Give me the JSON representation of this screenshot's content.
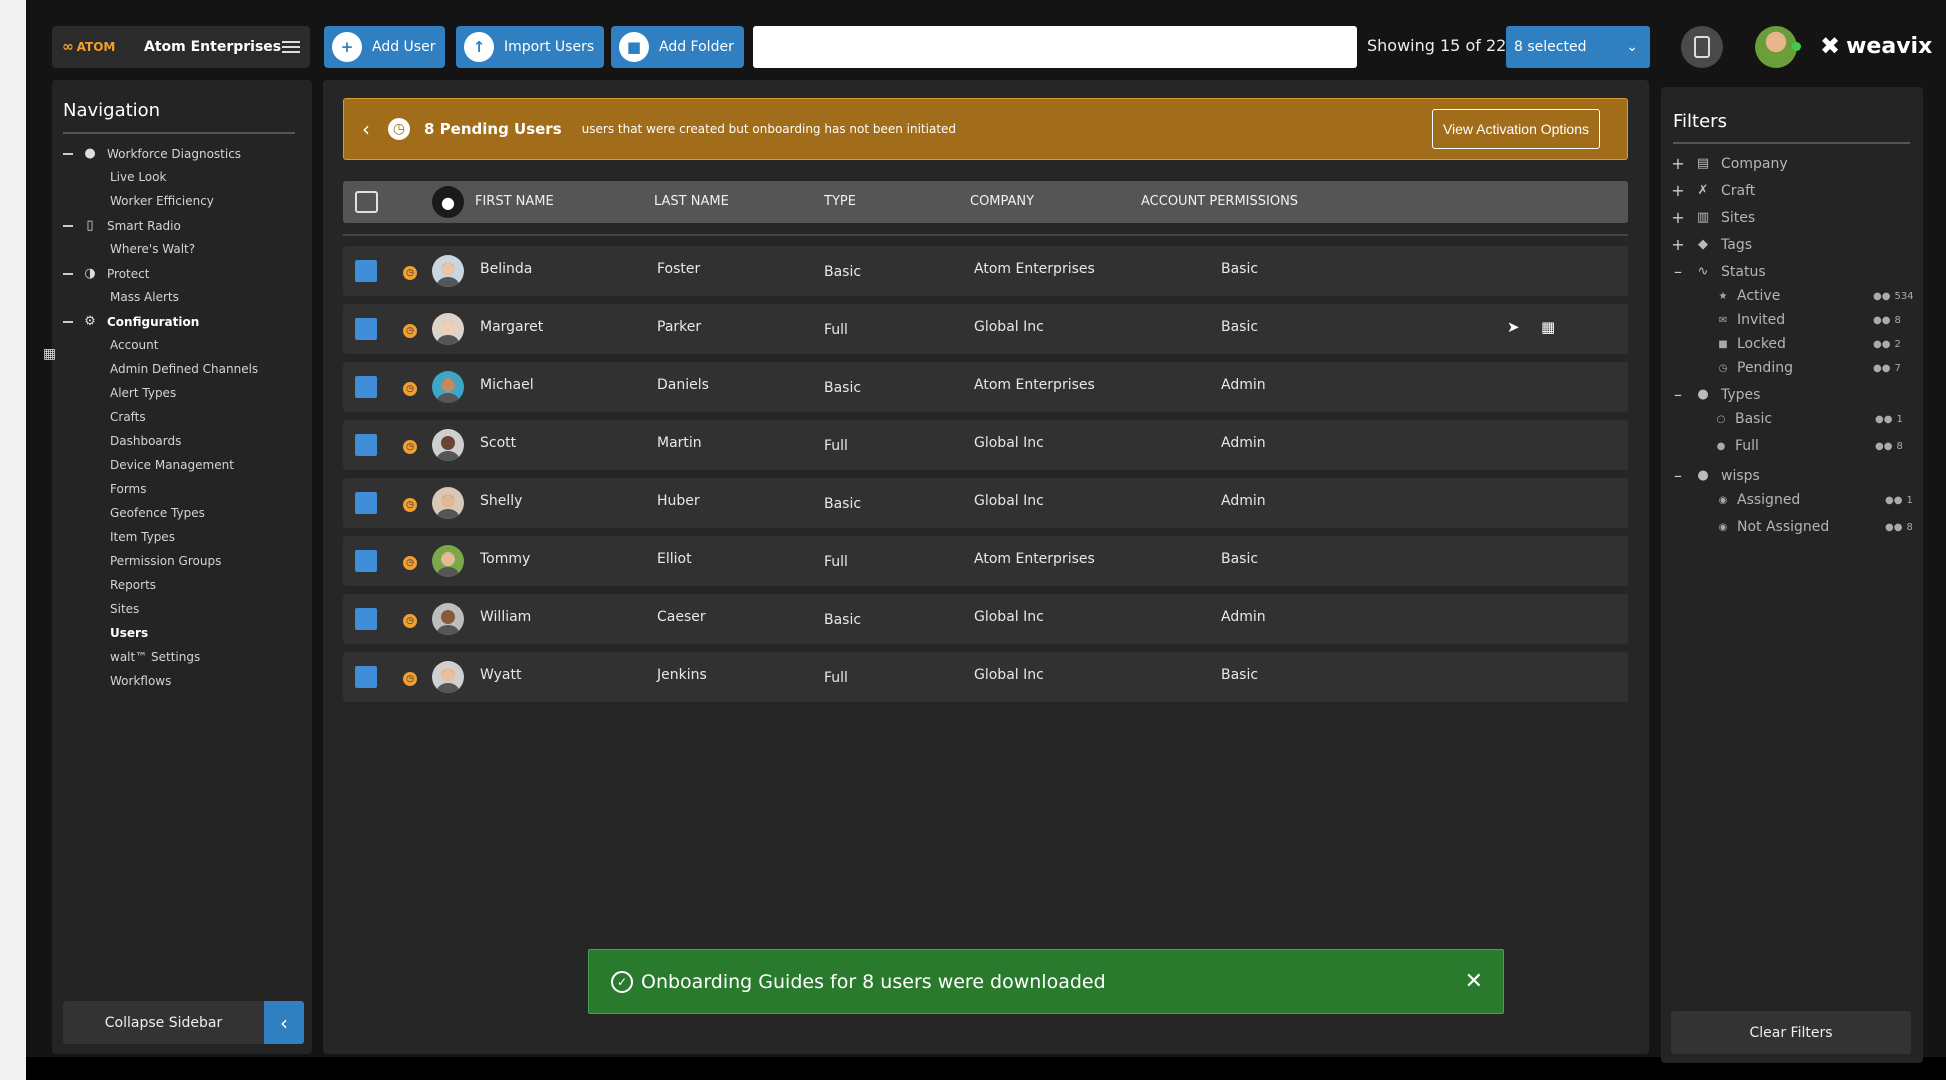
{
  "header": {
    "logo_text": "ATOM",
    "org_name": "Atom Enterprises",
    "add_user": "Add User",
    "import_users": "Import Users",
    "add_folder": "Add Folder",
    "search_placeholder": "",
    "showing": "Showing 15 of 22",
    "selected": "8 selected",
    "brand": "weavix"
  },
  "sidebar": {
    "title": "Navigation",
    "groups": [
      {
        "label": "Workforce Diagnostics",
        "icon": "person-icon",
        "items": [
          "Live Look",
          "Worker Efficiency"
        ]
      },
      {
        "label": "Smart Radio",
        "icon": "radio-icon",
        "items": [
          "Where's Walt?"
        ]
      },
      {
        "label": "Protect",
        "icon": "shield-icon",
        "items": [
          "Mass Alerts"
        ]
      },
      {
        "label": "Configuration",
        "icon": "gear-icon",
        "items": [
          "Account",
          "Admin Defined Channels",
          "Alert Types",
          "Crafts",
          "Dashboards",
          "Device Management",
          "Forms",
          "Geofence Types",
          "Item Types",
          "Permission Groups",
          "Reports",
          "Sites",
          "Users",
          "walt™ Settings",
          "Workflows"
        ]
      }
    ],
    "collapse_label": "Collapse Sidebar"
  },
  "banner": {
    "title": "8 Pending Users",
    "description": "users that were created but onboarding has not been initiated",
    "button": "View Activation Options"
  },
  "table": {
    "columns": [
      "FIRST NAME",
      "LAST NAME",
      "TYPE",
      "COMPANY",
      "ACCOUNT PERMISSIONS"
    ],
    "rows": [
      {
        "first": "Belinda",
        "last": "Foster",
        "type": "Basic",
        "company": "Atom Enterprises",
        "permissions": "Basic",
        "skin": "#e8c4a8",
        "hair": "#6b4a30",
        "bg": "#c9d6e0"
      },
      {
        "first": "Margaret",
        "last": "Parker",
        "type": "Full",
        "company": "Global Inc",
        "permissions": "Basic",
        "skin": "#f0cfb5",
        "hair": "#b0602e",
        "bg": "#dcd3cb"
      },
      {
        "first": "Michael",
        "last": "Daniels",
        "type": "Basic",
        "company": "Atom Enterprises",
        "permissions": "Admin",
        "skin": "#c48a62",
        "hair": "#2a1c14",
        "bg": "#3ba7c9"
      },
      {
        "first": "Scott",
        "last": "Martin",
        "type": "Full",
        "company": "Global Inc",
        "permissions": "Admin",
        "skin": "#6b4530",
        "hair": "#1c1c1c",
        "bg": "#cfcfcf"
      },
      {
        "first": "Shelly",
        "last": "Huber",
        "type": "Basic",
        "company": "Global Inc",
        "permissions": "Admin",
        "skin": "#e2b894",
        "hair": "#4a3222",
        "bg": "#d8c8b8"
      },
      {
        "first": "Tommy",
        "last": "Elliot",
        "type": "Full",
        "company": "Atom Enterprises",
        "permissions": "Basic",
        "skin": "#e6bc98",
        "hair": "#3a2a1c",
        "bg": "#7aa84a"
      },
      {
        "first": "William",
        "last": "Caeser",
        "type": "Basic",
        "company": "Global Inc",
        "permissions": "Admin",
        "skin": "#8a5a3c",
        "hair": "#1a1a1a",
        "bg": "#bdbdbd"
      },
      {
        "first": "Wyatt",
        "last": "Jenkins",
        "type": "Full",
        "company": "Global Inc",
        "permissions": "Basic",
        "skin": "#e6c0a0",
        "hair": "#5a3e28",
        "bg": "#d0d0d0"
      }
    ]
  },
  "toast": {
    "message": "Onboarding Guides for 8 users were downloaded"
  },
  "filters": {
    "title": "Filters",
    "collapsed": [
      {
        "label": "Company",
        "icon": "building-icon"
      },
      {
        "label": "Craft",
        "icon": "tools-icon"
      },
      {
        "label": "Sites",
        "icon": "site-icon"
      },
      {
        "label": "Tags",
        "icon": "tag-icon"
      }
    ],
    "status": {
      "label": "Status",
      "items": [
        {
          "label": "Active",
          "count": "534",
          "icon": "star-icon"
        },
        {
          "label": "Invited",
          "count": "8",
          "icon": "envelope-icon"
        },
        {
          "label": "Locked",
          "count": "2",
          "icon": "lock-icon"
        },
        {
          "label": "Pending",
          "count": "7",
          "icon": "clock-icon"
        }
      ]
    },
    "types": {
      "label": "Types",
      "items": [
        {
          "label": "Basic",
          "count": "1",
          "icon": "person-outline-icon"
        },
        {
          "label": "Full",
          "count": "8",
          "icon": "person-icon"
        }
      ]
    },
    "wisps": {
      "label": "wisps",
      "items": [
        {
          "label": "Assigned",
          "count": "1",
          "icon": "wisp-icon"
        },
        {
          "label": "Not Assigned",
          "count": "8",
          "icon": "wisp-icon"
        }
      ]
    },
    "clear_label": "Clear Filters"
  },
  "colors": {
    "accent": "#2f7fc1",
    "pending": "#f0a030",
    "banner": "#a26d1a",
    "toast": "#2a7a2e"
  }
}
